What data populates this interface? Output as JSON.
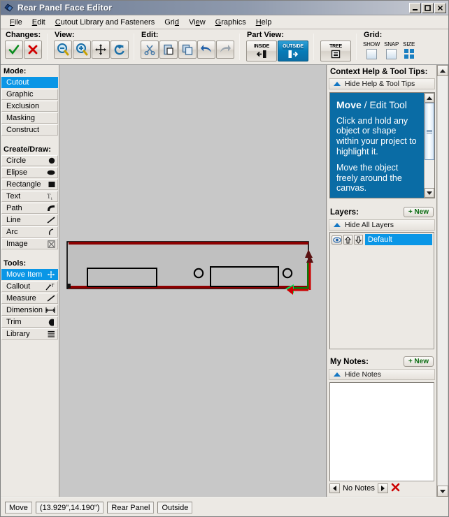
{
  "window": {
    "title": "Rear Panel Face Editor",
    "icon": "app-diamond-icon",
    "minimize": "_",
    "maximize": "□",
    "close": "✕"
  },
  "menubar": {
    "items": [
      {
        "label": "File",
        "accel": "F"
      },
      {
        "label": "Edit",
        "accel": "E"
      },
      {
        "label": "Cutout Library and Fasteners",
        "accel": "C"
      },
      {
        "label": "Grid",
        "accel": "d"
      },
      {
        "label": "View",
        "accel": "e"
      },
      {
        "label": "Graphics",
        "accel": "G"
      },
      {
        "label": "Help",
        "accel": "H"
      }
    ]
  },
  "toolbar": {
    "groups": [
      {
        "label": "Changes:",
        "buttons": [
          {
            "name": "accept-changes-button",
            "icon": "check-icon",
            "glyph": "✓"
          },
          {
            "name": "cancel-changes-button",
            "icon": "cross-icon",
            "glyph": "✕"
          }
        ]
      },
      {
        "label": "View:",
        "buttons": [
          {
            "name": "zoom-out-button",
            "icon": "zoom-out-icon"
          },
          {
            "name": "zoom-in-button",
            "icon": "zoom-in-icon"
          },
          {
            "name": "pan-button",
            "icon": "pan-move-icon"
          },
          {
            "name": "refresh-button",
            "icon": "refresh-icon"
          }
        ]
      },
      {
        "label": "Edit:",
        "buttons": [
          {
            "name": "cut-button",
            "icon": "scissors-icon"
          },
          {
            "name": "paste-button",
            "icon": "clipboard-icon"
          },
          {
            "name": "copy-button",
            "icon": "copy-icon"
          },
          {
            "name": "undo-button",
            "icon": "undo-arrow-icon"
          },
          {
            "name": "redo-button",
            "icon": "redo-arrow-icon"
          }
        ]
      },
      {
        "label": "Part View:",
        "buttons": [
          {
            "name": "inside-view-button",
            "icon": "arrow-into-icon",
            "label": "INSIDE",
            "selected": false
          },
          {
            "name": "outside-view-button",
            "icon": "arrow-out-icon",
            "label": "OUTSIDE",
            "selected": true
          }
        ]
      },
      {
        "label": "",
        "buttons": [
          {
            "name": "tree-button",
            "icon": "tree-list-icon",
            "label": "TREE",
            "selected": false
          }
        ]
      },
      {
        "label": "Grid:",
        "checks": [
          {
            "name": "grid-show-checkbox",
            "caption": "SHOW",
            "checked": false
          },
          {
            "name": "grid-snap-checkbox",
            "caption": "SNAP",
            "checked": false
          },
          {
            "name": "grid-size-button",
            "caption": "SIZE",
            "icon": "grid-size-icon"
          }
        ]
      }
    ]
  },
  "sidebar": {
    "mode": {
      "heading": "Mode:",
      "items": [
        {
          "label": "Cutout",
          "selected": true
        },
        {
          "label": "Graphic",
          "selected": false
        },
        {
          "label": "Exclusion",
          "selected": false
        },
        {
          "label": "Masking",
          "selected": false
        },
        {
          "label": "Construct",
          "selected": false
        }
      ]
    },
    "create": {
      "heading": "Create/Draw:",
      "items": [
        {
          "label": "Circle",
          "icon": "circle-icon",
          "selected": false
        },
        {
          "label": "Elipse",
          "icon": "ellipse-icon",
          "selected": false
        },
        {
          "label": "Rectangle",
          "icon": "rectangle-icon",
          "selected": false
        },
        {
          "label": "Text",
          "icon": "text-icon",
          "selected": false
        },
        {
          "label": "Path",
          "icon": "path-icon",
          "selected": false
        },
        {
          "label": "Line",
          "icon": "line-icon",
          "selected": false
        },
        {
          "label": "Arc",
          "icon": "arc-icon",
          "selected": false
        },
        {
          "label": "Image",
          "icon": "image-icon",
          "selected": false
        }
      ]
    },
    "tools": {
      "heading": "Tools:",
      "items": [
        {
          "label": "Move Item",
          "icon": "move-item-icon",
          "selected": true
        },
        {
          "label": "Callout",
          "icon": "callout-icon",
          "selected": false
        },
        {
          "label": "Measure",
          "icon": "measure-icon",
          "selected": false
        },
        {
          "label": "Dimension",
          "icon": "dimension-icon",
          "selected": false
        },
        {
          "label": "Trim",
          "icon": "trim-icon",
          "selected": false
        },
        {
          "label": "Library",
          "icon": "library-icon",
          "selected": false
        }
      ]
    }
  },
  "help": {
    "title": "Context Help & Tool Tips:",
    "toggle_label": "Hide Help & Tool Tips",
    "heading_bold": "Move",
    "heading_thin": " / Edit Tool",
    "paragraphs": [
      "Click and hold any object or shape within your project to highlight it.",
      "Move the object freely around the canvas."
    ],
    "bg_color": "#0a6ca5"
  },
  "layers": {
    "title": "Layers:",
    "new_label": "+ New",
    "toggle_label": "Hide All Layers",
    "items": [
      {
        "name": "Default",
        "visible": true,
        "selected": true
      }
    ]
  },
  "notes": {
    "title": "My Notes:",
    "new_label": "+ New",
    "toggle_label": "Hide Notes",
    "content": "",
    "status": "No Notes",
    "prev_icon": "prev-arrow-icon",
    "next_icon": "next-arrow-icon",
    "delete_icon": "delete-x-icon"
  },
  "statusbar": {
    "fields": [
      {
        "name": "status-tool",
        "value": "Move"
      },
      {
        "name": "status-coordinates",
        "value": "(13.929\",14.190\")"
      },
      {
        "name": "status-part",
        "value": "Rear Panel"
      },
      {
        "name": "status-side",
        "value": "Outside"
      }
    ]
  },
  "canvas": {
    "name": "panel-drawing-canvas",
    "background": "#c8c8c8",
    "panel_fill": "#c0c0c0",
    "outline_color": "#000000",
    "highlight_color": "#8b0000",
    "shapes": [
      {
        "name": "panel-outline",
        "type": "rect"
      },
      {
        "name": "cutout-rect-left",
        "type": "rect"
      },
      {
        "name": "cutout-rect-right",
        "type": "rect"
      },
      {
        "name": "cutout-circle-middle",
        "type": "circle"
      },
      {
        "name": "cutout-circle-right",
        "type": "circle"
      },
      {
        "name": "move-handle-arrows",
        "type": "handle"
      }
    ]
  }
}
